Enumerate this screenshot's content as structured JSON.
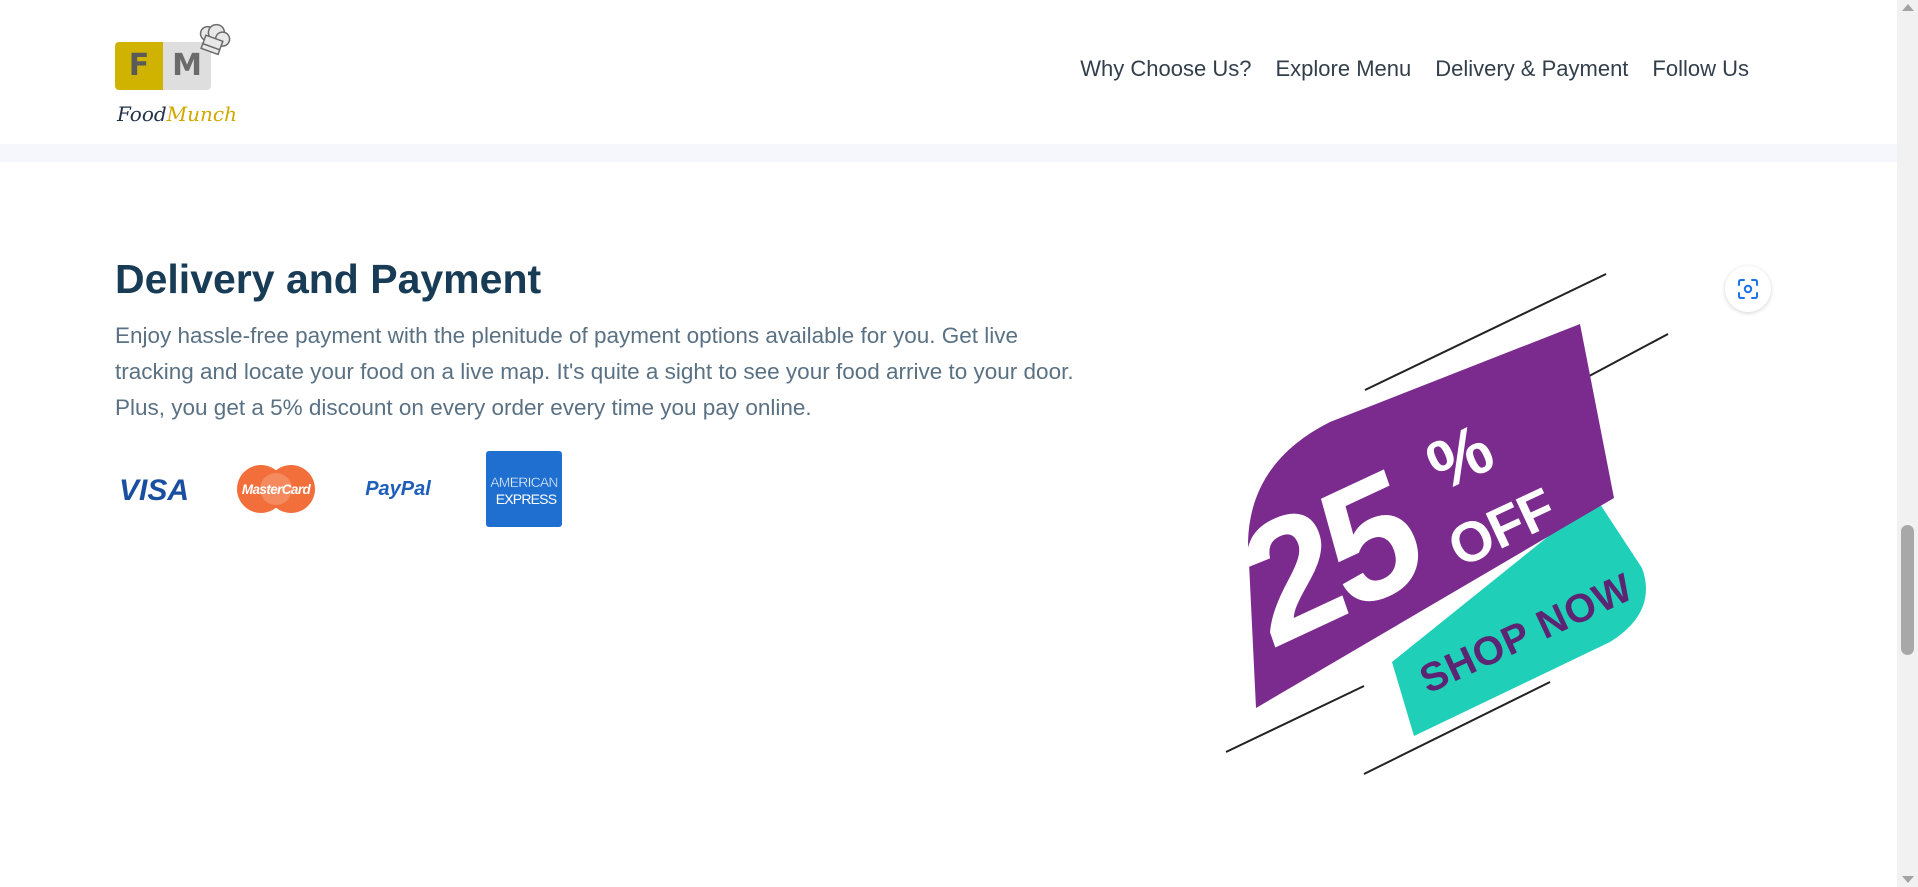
{
  "navbar": {
    "logo": {
      "letter_f": "F",
      "letter_m": "M",
      "brand_part1": "Food",
      "brand_part2": "Munch"
    },
    "links": [
      {
        "label": "Why Choose Us?"
      },
      {
        "label": "Explore Menu"
      },
      {
        "label": "Delivery & Payment"
      },
      {
        "label": "Follow Us"
      }
    ]
  },
  "section": {
    "title": "Delivery and Payment",
    "description": "Enjoy hassle-free payment with the plenitude of payment options available for you. Get live tracking and locate your food on a live map. It's quite a sight to see your food arrive to your door. Plus, you get a 5% discount on every order every time you pay online.",
    "payment_cards": [
      {
        "name": "visa-card-icon",
        "label": "VISA"
      },
      {
        "name": "mastercard-icon",
        "label": "MasterCard"
      },
      {
        "name": "paypal-icon",
        "label": "PayPal"
      },
      {
        "name": "american-express-icon",
        "label_line1": "AMERICAN",
        "label_line2": "EXPRESS"
      }
    ],
    "promo": {
      "number": "25",
      "percent": "%",
      "off": "OFF",
      "cta": "SHOP NOW"
    }
  },
  "colors": {
    "heading": "#183b56",
    "body_text": "#5a7184",
    "nav_text": "#323f4b",
    "logo_yellow": "#d0b200",
    "promo_purple": "#7b2b8e",
    "promo_teal": "#1fcfb8",
    "visa_blue": "#1a4fa0",
    "mastercard_orange": "#f26f3c",
    "amex_blue": "#1f6fd1"
  },
  "icons": {
    "lens": "image-search-icon",
    "chef_hat": "chef-hat-icon"
  }
}
